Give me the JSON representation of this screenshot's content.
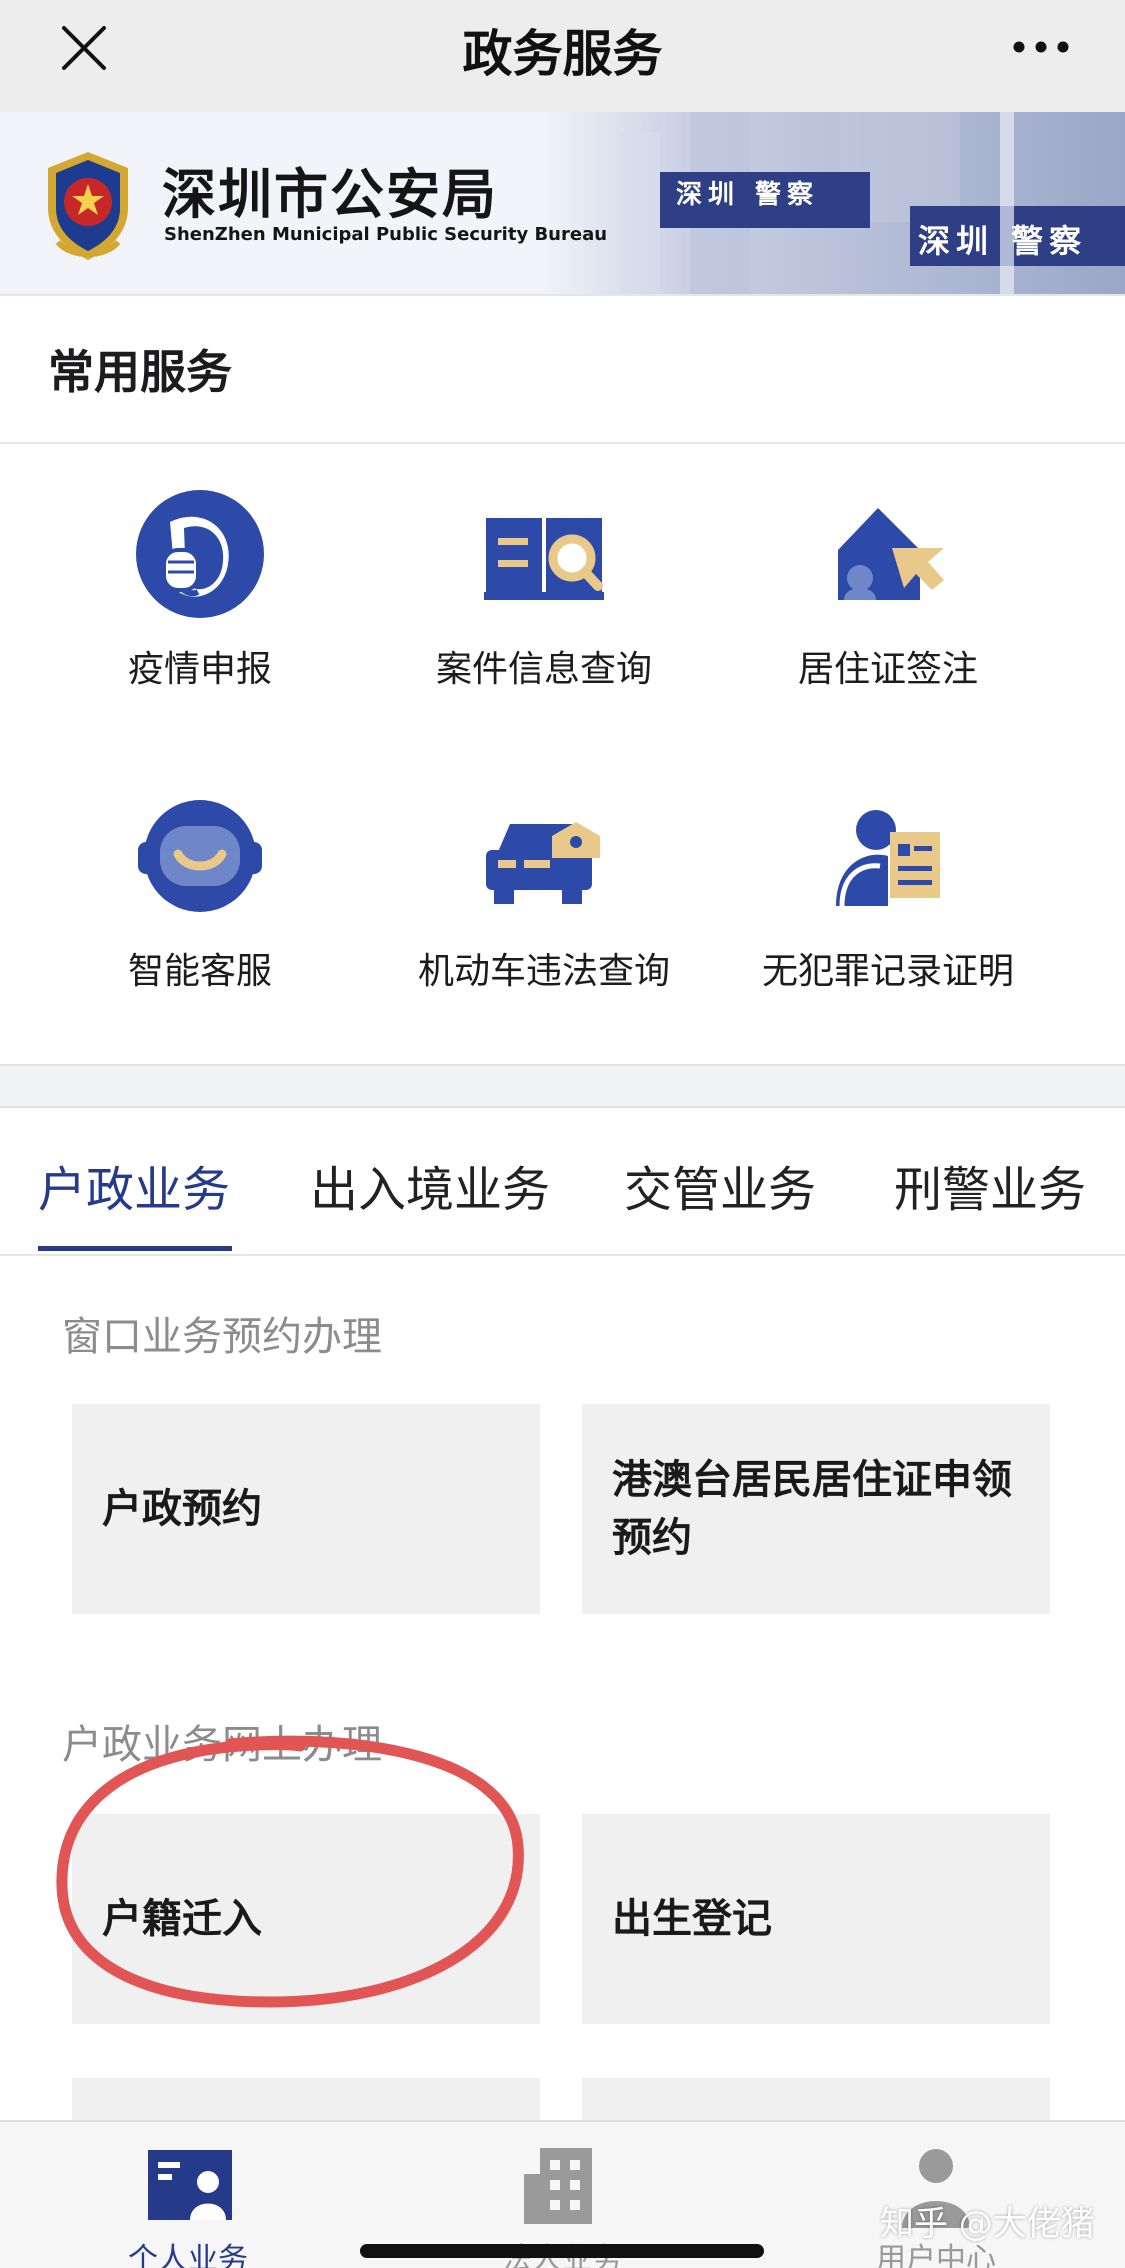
{
  "navbar": {
    "title": "政务服务",
    "close_icon": "close-icon",
    "more_icon": "more-icon"
  },
  "banner": {
    "title": "深圳市公安局",
    "subtitle": "ShenZhen Municipal Public Security Bureau",
    "photo_text_left": "深圳 警察",
    "photo_text_right": "深圳 警察"
  },
  "common_services": {
    "title": "常用服务",
    "items": [
      {
        "label": "疫情申报",
        "icon": "mask-face-icon"
      },
      {
        "label": "案件信息查询",
        "icon": "book-search-icon"
      },
      {
        "label": "居住证签注",
        "icon": "house-cursor-icon"
      },
      {
        "label": "智能客服",
        "icon": "robot-face-icon"
      },
      {
        "label": "机动车违法查询",
        "icon": "car-police-icon"
      },
      {
        "label": "无犯罪记录证明",
        "icon": "person-document-icon"
      }
    ]
  },
  "business_tabs": [
    {
      "label": "户政业务",
      "active": true
    },
    {
      "label": "出入境业务",
      "active": false
    },
    {
      "label": "交管业务",
      "active": false
    },
    {
      "label": "刑警业务",
      "active": false
    }
  ],
  "groups": [
    {
      "title": "窗口业务预约办理",
      "cards": [
        "户政预约",
        "港澳台居民居住证申领预约"
      ]
    },
    {
      "title": "户政业务网上办理",
      "cards": [
        "户籍迁入",
        "出生登记"
      ]
    }
  ],
  "tabbar": {
    "items": [
      {
        "label": "个人业务",
        "icon": "id-card-icon",
        "active": true
      },
      {
        "label": "法人业务",
        "icon": "building-icon",
        "active": false
      },
      {
        "label": "用户中心",
        "icon": "user-icon",
        "active": false
      }
    ]
  },
  "watermark": "知乎 @大佬猪",
  "colors": {
    "accent": "#253a88",
    "icon_blue": "#2d4aa8",
    "icon_gold": "#e9c98a",
    "annotation_red": "#e25555"
  }
}
